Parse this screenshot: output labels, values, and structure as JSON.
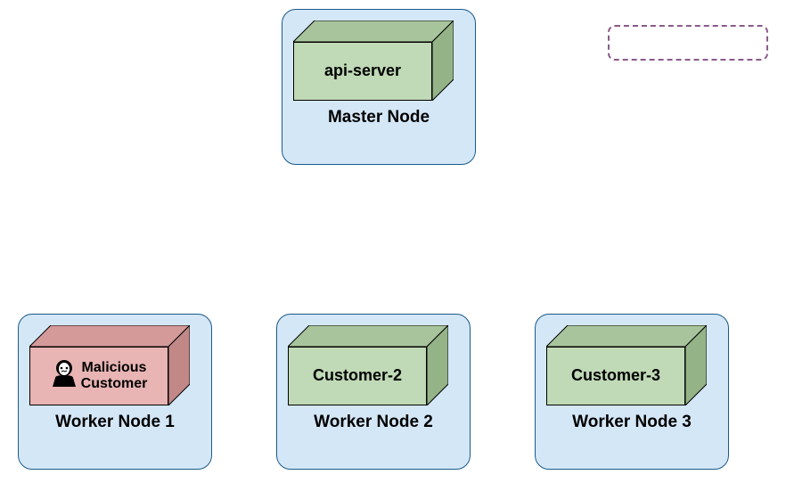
{
  "master": {
    "node_label": "Master Node",
    "box_label": "api-server"
  },
  "workers": [
    {
      "node_label": "Worker Node 1",
      "box_label_line1": "Malicious",
      "box_label_line2": "Customer",
      "is_malicious": true
    },
    {
      "node_label": "Worker Node 2",
      "box_label": "Customer-2",
      "is_malicious": false
    },
    {
      "node_label": "Worker Node 3",
      "box_label": "Customer-3",
      "is_malicious": false
    }
  ],
  "colors": {
    "container_bg": "#d4e7f7",
    "container_border": "#1a5a8a",
    "green_fill": "#c0d9b6",
    "green_shade_top": "#a8c49c",
    "green_shade_side": "#94b387",
    "red_fill": "#e8b4b4",
    "red_shade_top": "#d49999",
    "red_shade_side": "#c28888",
    "dashed_border": "#8b5a8b"
  }
}
